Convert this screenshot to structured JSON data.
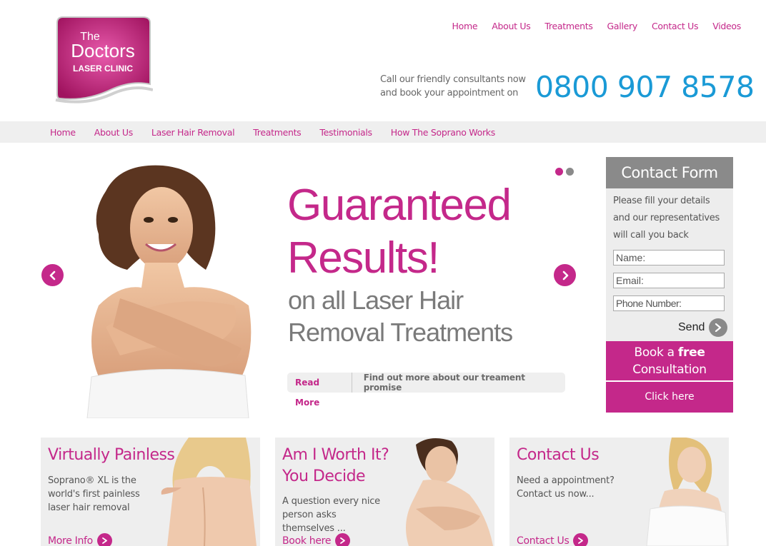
{
  "brand": {
    "logo_line1": "The",
    "logo_line2": "Doctors",
    "logo_line3": "LASER CLINIC",
    "accent": "#c4288a",
    "phone_color": "#1a9ad6"
  },
  "top_nav": [
    {
      "label": "Home"
    },
    {
      "label": "About Us"
    },
    {
      "label": "Treatments"
    },
    {
      "label": "Gallery"
    },
    {
      "label": "Contact Us"
    },
    {
      "label": "Videos"
    }
  ],
  "call": {
    "line1": "Call our friendly consultants now",
    "line2": "and book your appointment on",
    "phone": "0800 907 8578"
  },
  "main_nav": [
    {
      "label": "Home"
    },
    {
      "label": "About Us"
    },
    {
      "label": "Laser Hair Removal"
    },
    {
      "label": "Treatments"
    },
    {
      "label": "Testimonials"
    },
    {
      "label": "How The Soprano Works"
    }
  ],
  "hero": {
    "headline1": "Guaranteed",
    "headline2": "Results!",
    "sub1": "on all Laser Hair",
    "sub2": "Removal Treatments",
    "read_more": "Read More",
    "promise": "Find out more about our treament promise",
    "slide_count": 2,
    "active_slide": 1,
    "prev_icon": "chevron-left-icon",
    "next_icon": "chevron-right-icon"
  },
  "contact_form": {
    "title": "Contact Form",
    "intro1": "Please fill your details",
    "intro2": "and our representatives",
    "intro3": "will call you back",
    "name_value": "Name:",
    "email_value": "Email:",
    "phone_value": "Phone Number:",
    "send": "Send",
    "book_prefix": "Book a",
    "book_bold": "free",
    "book_suffix": "Consultation",
    "click_here": "Click here"
  },
  "cards": [
    {
      "title": "Virtually Painless",
      "text1": "Soprano® XL is the",
      "text2": "world's first painless",
      "text3": "laser hair removal",
      "link": "More Info"
    },
    {
      "title1": "Am I Worth It?",
      "title2": "You Decide",
      "text1": "A question every nice",
      "text2": "person asks",
      "text3": "themselves ...",
      "link": "Book here"
    },
    {
      "title": "Contact Us",
      "text1": "Need a appointment?",
      "text2": "Contact us now...",
      "link": "Contact Us"
    }
  ]
}
